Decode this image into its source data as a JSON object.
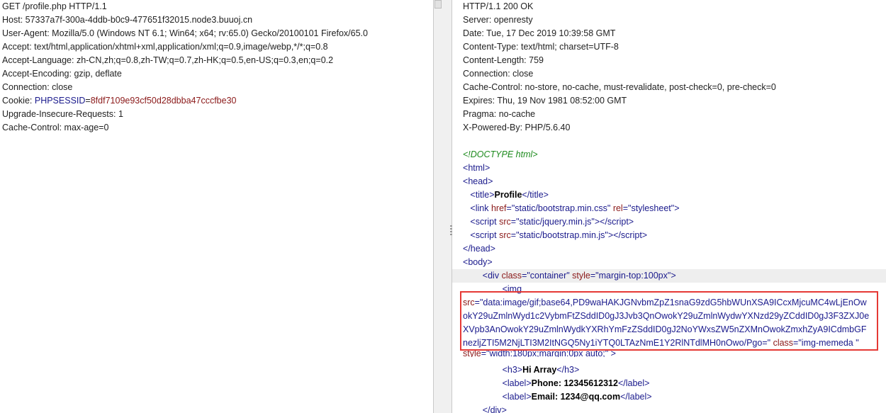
{
  "request": {
    "lines": [
      "GET /profile.php HTTP/1.1",
      "Host: 57337a7f-300a-4ddb-b0c9-477651f32015.node3.buuoj.cn",
      "User-Agent: Mozilla/5.0 (Windows NT 6.1; Win64; x64; rv:65.0) Gecko/20100101 Firefox/65.0",
      "Accept: text/html,application/xhtml+xml,application/xml;q=0.9,image/webp,*/*;q=0.8",
      "Accept-Language: zh-CN,zh;q=0.8,zh-TW;q=0.7,zh-HK;q=0.5,en-US;q=0.3,en;q=0.2",
      "Accept-Encoding: gzip, deflate",
      "Connection: close"
    ],
    "cookie_label": "Cookie: ",
    "cookie_key": "PHPSESSID",
    "cookie_eq": "=",
    "cookie_value": "8fdf7109e93cf50d28dbba47cccfbe30",
    "after_lines": [
      "Upgrade-Insecure-Requests: 1",
      "Cache-Control: max-age=0"
    ]
  },
  "response": {
    "headers": [
      "HTTP/1.1 200 OK",
      "Server: openresty",
      "Date: Tue, 17 Dec 2019 10:39:58 GMT",
      "Content-Type: text/html; charset=UTF-8",
      "Content-Length: 759",
      "Connection: close",
      "Cache-Control: no-store, no-cache, must-revalidate, post-check=0, pre-check=0",
      "Expires: Thu, 19 Nov 1981 08:52:00 GMT",
      "Pragma: no-cache",
      "X-Powered-By: PHP/5.6.40"
    ],
    "doctype": "<!DOCTYPE html>",
    "html_open": "html",
    "head_open": "head",
    "title_tag": "title",
    "title_text": "Profile",
    "title_close": "/title",
    "link_tag": "link",
    "link_href_attr": "href",
    "link_href_val": "\"static/bootstrap.min.css\"",
    "link_rel_attr": "rel",
    "link_rel_val": "\"stylesheet\"",
    "script_tag": "script",
    "script_src_attr": "src",
    "script1_src": "\"static/jquery.min.js\"",
    "script2_src": "\"static/bootstrap.min.js\"",
    "script_close": "/script",
    "head_close": "/head",
    "body_open": "body",
    "div_tag": "div",
    "div_class_attr": "class",
    "div_class_val": "\"container\"",
    "div_style_attr": "style",
    "div_style_val": "\"margin-top:100px\"",
    "img_tag": "img",
    "img_src_attr": "src",
    "b64_lines": [
      "\"data:image/gif;base64,PD9waHAKJGNvbmZpZ1snaG9zdG5hbWUnXSA9ICcxMjcuMC4wLjEnOw",
      "okY29uZmlnWyd1c2VybmFtZSddID0gJ3Jvb3QnOwokY29uZmlnWydwYXNzd29yZCddID0gJ3F3ZXJ0e",
      "XVpb3AnOwokY29uZmlnWydkYXRhYmFzZSddID0gJ2NoYWxsZW5nZXMnOwokZmxhZyA9ICdmbGF",
      "nezljZTI5M2NjLTI3M2ItNGQ5Ny1iYTQ0LTAzNmE1Y2RlNTdlMH0nOwo/Pgo=\""
    ],
    "img_class_attr": "class",
    "img_class_val": "\"img-memeda \"",
    "img_style_attr": "style",
    "img_style_val": "\"width:180px;margin:0px auto;\"",
    "h3_tag": "h3",
    "h3_text": "Hi Array",
    "h3_close": "/h3",
    "label_tag": "label",
    "label_close": "/label",
    "phone_text": "Phone: 12345612312",
    "email_text": "Email: 1234@qq.com",
    "div_close": "/div"
  }
}
